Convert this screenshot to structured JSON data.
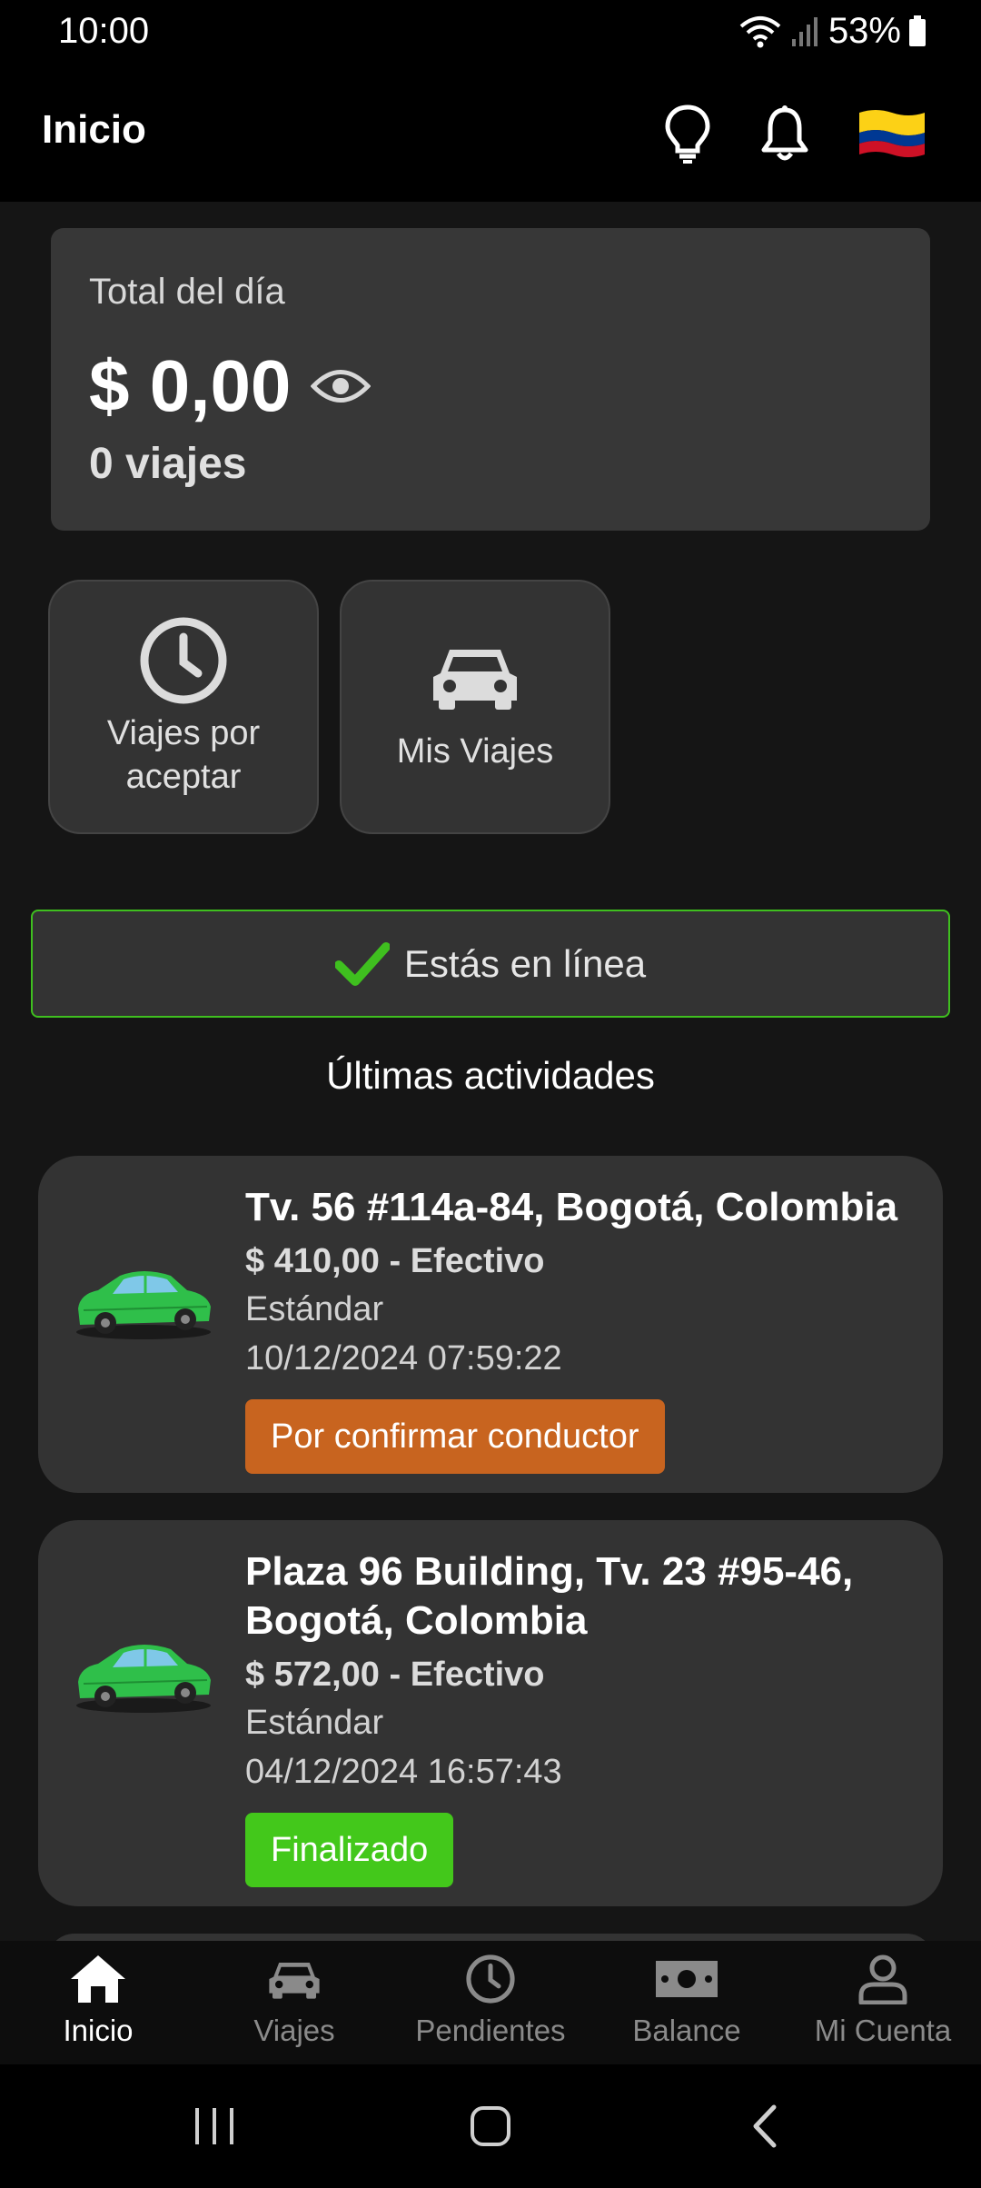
{
  "status_bar": {
    "time": "10:00",
    "battery": "53%"
  },
  "app_bar": {
    "title": "Inicio",
    "icons": [
      "lightbulb-icon",
      "bell-icon",
      "colombia-flag-icon"
    ]
  },
  "total_card": {
    "label": "Total del día",
    "amount": "$ 0,00",
    "trips": "0 viajes"
  },
  "tiles": [
    {
      "label": "Viajes por aceptar",
      "icon": "clock-icon"
    },
    {
      "label": "Mis Viajes",
      "icon": "car-icon"
    }
  ],
  "online_status": {
    "text": "Estás en línea",
    "color": "#3fbf1f"
  },
  "activities_title": "Últimas actividades",
  "activities": [
    {
      "address": "Tv. 56 #114a-84, Bogotá, Colombia",
      "price": "$ 410,00 - Efectivo",
      "type": "Estándar",
      "date": "10/12/2024 07:59:22",
      "status": "Por confirmar conductor",
      "status_color": "#c8641f"
    },
    {
      "address": "Plaza 96 Building, Tv. 23 #95-46, Bogotá, Colombia",
      "price": "$ 572,00 - Efectivo",
      "type": "Estándar",
      "date": "04/12/2024 16:57:43",
      "status": "Finalizado",
      "status_color": "#43c81b"
    }
  ],
  "bottom_nav": [
    {
      "label": "Inicio",
      "icon": "home-icon",
      "active": true
    },
    {
      "label": "Viajes",
      "icon": "car-icon",
      "active": false
    },
    {
      "label": "Pendientes",
      "icon": "clock-icon",
      "active": false
    },
    {
      "label": "Balance",
      "icon": "money-icon",
      "active": false
    },
    {
      "label": "Mi Cuenta",
      "icon": "user-icon",
      "active": false
    }
  ]
}
